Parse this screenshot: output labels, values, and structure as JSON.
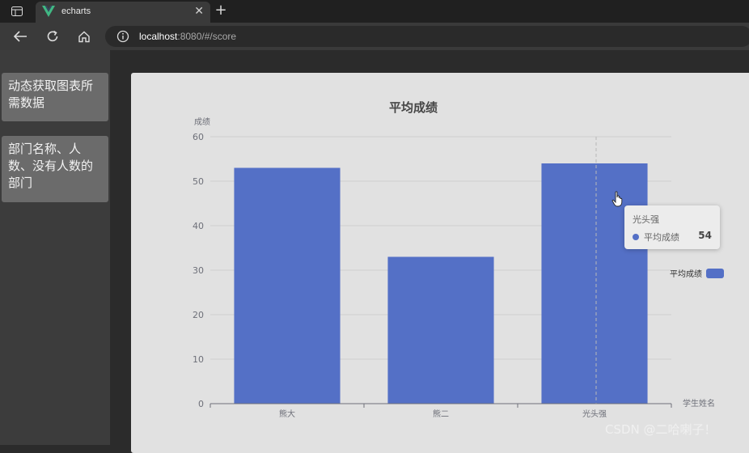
{
  "browser": {
    "tab_title": "echarts",
    "tab_close": "✕",
    "new_tab": "+",
    "url_host": "localhost",
    "url_rest": ":8080/#/score"
  },
  "sidebar": {
    "items": [
      {
        "label": "动态获取图表所需数据"
      },
      {
        "label": "部门名称、人数、没有人数的部门"
      }
    ]
  },
  "chart": {
    "tooltip": {
      "name": "光头强",
      "series": "平均成绩",
      "value": "54"
    }
  },
  "chart_data": {
    "type": "bar",
    "title": "平均成绩",
    "xlabel": "学生姓名",
    "ylabel": "成绩",
    "categories": [
      "熊大",
      "熊二",
      "光头强"
    ],
    "series": [
      {
        "name": "平均成绩",
        "values": [
          53,
          33,
          54
        ],
        "color": "#5470c6"
      }
    ],
    "ylim": [
      0,
      60
    ],
    "yticks": [
      "0",
      "10",
      "20",
      "30",
      "40",
      "50",
      "60"
    ],
    "grid": true,
    "legend": "right",
    "highlighted_category": "光头强"
  },
  "watermark": "CSDN @二哈喇子！"
}
